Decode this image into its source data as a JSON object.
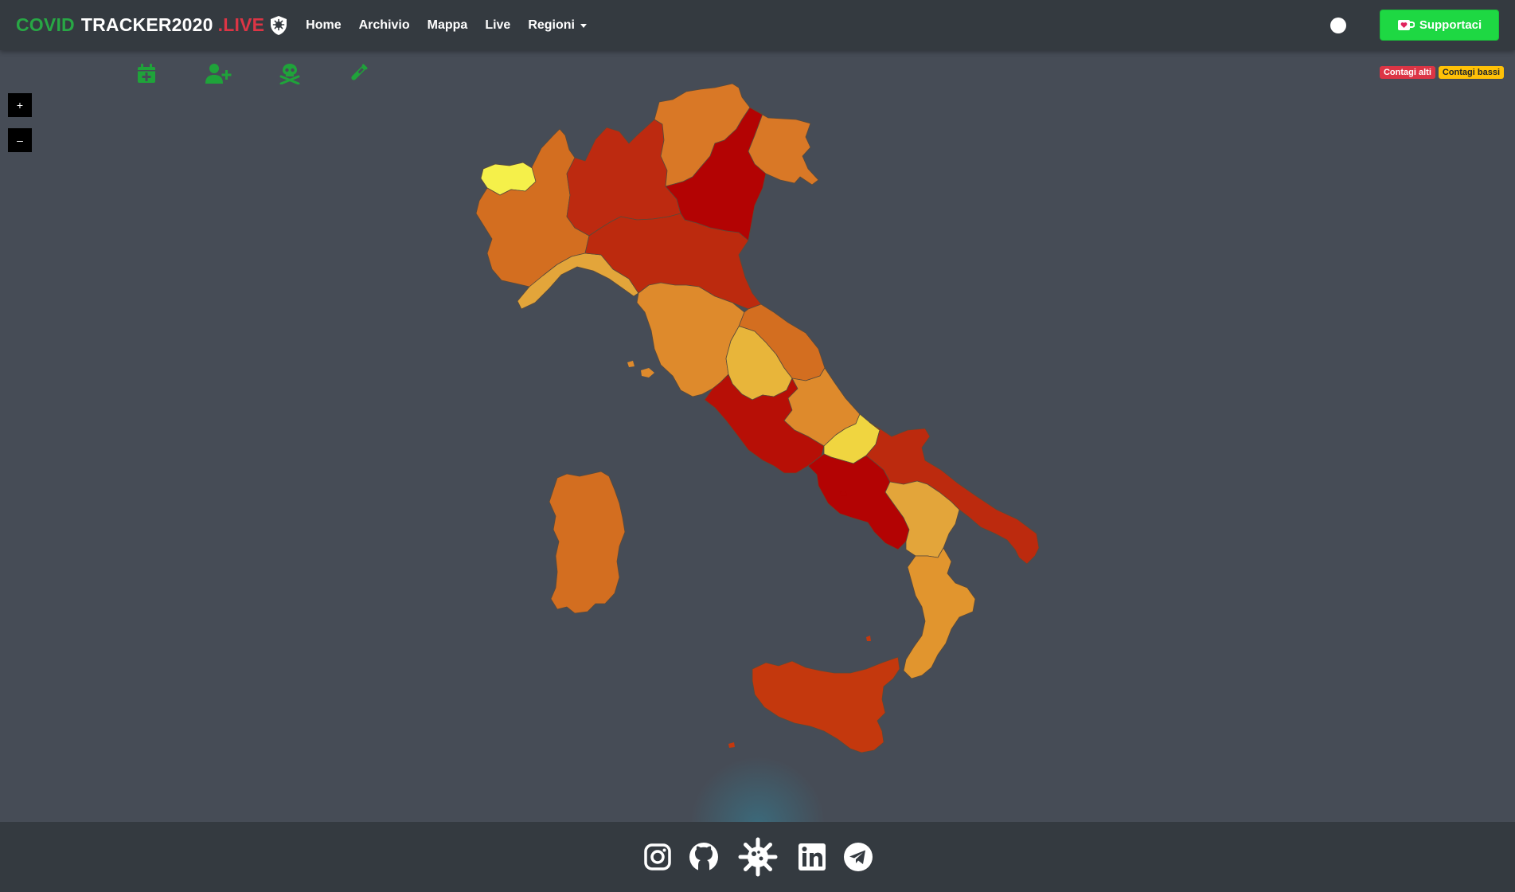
{
  "brand": {
    "part1": "COVID",
    "part2": "TRACKER2020",
    "part3": ".LIVE"
  },
  "nav": {
    "links": [
      "Home",
      "Archivio",
      "Mappa",
      "Live"
    ],
    "dropdown": "Regioni"
  },
  "support_button": "Supportaci",
  "metrics": [
    "nuovi-casi",
    "nuovi-positivi",
    "deceduti",
    "tamponi"
  ],
  "zoom": {
    "in": "+",
    "out": "–"
  },
  "legend": {
    "high": "Contagi alti",
    "low": "Contagi bassi"
  },
  "colors": {
    "navbar": "#343a40",
    "background": "#464c56",
    "brand_green": "#28a745",
    "brand_red": "#dc3545",
    "support": "#1ed843",
    "metric_icon": "#1fa33a"
  },
  "regions": [
    {
      "name": "Valle d'Aosta",
      "color": "#f5f04a"
    },
    {
      "name": "Piemonte",
      "color": "#d36e20"
    },
    {
      "name": "Lombardia",
      "color": "#bd2a10"
    },
    {
      "name": "Trentino-Alto Adige",
      "color": "#d97826"
    },
    {
      "name": "Veneto",
      "color": "#b30303"
    },
    {
      "name": "Friuli-Venezia Giulia",
      "color": "#d97826"
    },
    {
      "name": "Liguria",
      "color": "#e3a53a"
    },
    {
      "name": "Emilia-Romagna",
      "color": "#bc2a0e"
    },
    {
      "name": "Toscana",
      "color": "#de8a2c"
    },
    {
      "name": "Marche",
      "color": "#d36e20"
    },
    {
      "name": "Umbria",
      "color": "#e8b53a"
    },
    {
      "name": "Lazio",
      "color": "#b70f06"
    },
    {
      "name": "Abruzzo",
      "color": "#de8a2c"
    },
    {
      "name": "Molise",
      "color": "#f0d540"
    },
    {
      "name": "Campania",
      "color": "#b30303"
    },
    {
      "name": "Puglia",
      "color": "#bc2a0e"
    },
    {
      "name": "Basilicata",
      "color": "#e3a53a"
    },
    {
      "name": "Calabria",
      "color": "#e1952e"
    },
    {
      "name": "Sicilia",
      "color": "#c4380d"
    },
    {
      "name": "Sardegna",
      "color": "#d36e20"
    }
  ],
  "footer": {
    "links": [
      "instagram-icon",
      "github-icon",
      "covid-logo-icon",
      "linkedin-icon",
      "telegram-icon"
    ]
  }
}
